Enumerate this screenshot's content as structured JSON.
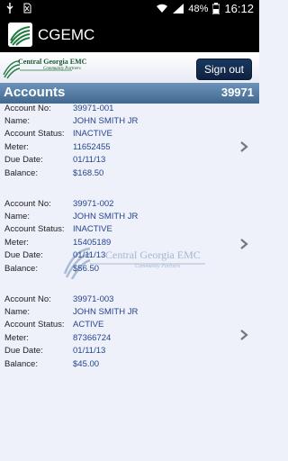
{
  "status_bar": {
    "battery": "48%",
    "time": "16:12"
  },
  "app_bar": {
    "title": "CGEMC"
  },
  "header": {
    "brand_name": "Central Georgia EMC",
    "brand_sub": "Community Partners",
    "signout_label": "Sign out"
  },
  "accounts_bar": {
    "title": "Accounts",
    "number": "39971"
  },
  "labels": {
    "account_no": "Account No:",
    "name": "Name:",
    "status": "Account Status:",
    "meter": "Meter:",
    "due_date": "Due Date:",
    "balance": "Balance:"
  },
  "accounts": [
    {
      "account_no": "39971-001",
      "name": "JOHN SMITH JR",
      "status": "INACTIVE",
      "meter": "11652455",
      "due_date": "01/11/13",
      "balance": "$168.50"
    },
    {
      "account_no": "39971-002",
      "name": "JOHN SMITH JR",
      "status": "INACTIVE",
      "meter": "15405189",
      "due_date": "01/11/13",
      "balance": "$56.50"
    },
    {
      "account_no": "39971-003",
      "name": "JOHN SMITH JR",
      "status": "ACTIVE",
      "meter": "87366724",
      "due_date": "01/11/13",
      "balance": "$45.00"
    }
  ],
  "watermark": {
    "name": "Central Georgia EMC",
    "sub": "Community Partners"
  },
  "icons": {
    "status_left": [
      "usb-icon",
      "sd-card-icon"
    ],
    "status_right": [
      "wifi-icon",
      "signal-icon",
      "battery-icon"
    ],
    "chevron": "chevron-right-icon"
  }
}
